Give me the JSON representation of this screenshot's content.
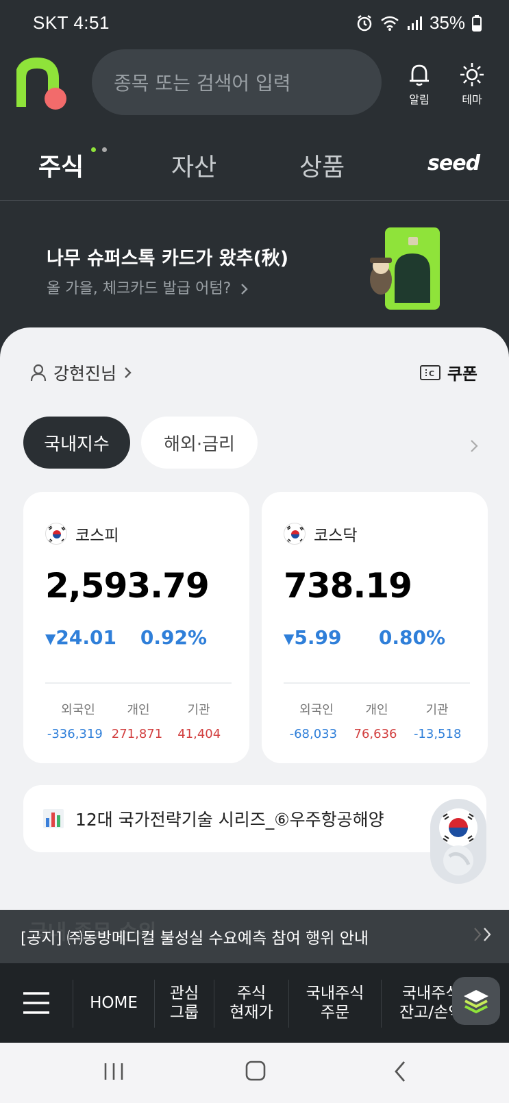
{
  "status_bar": {
    "carrier_time": "SKT 4:51",
    "battery": "35%"
  },
  "header": {
    "search_placeholder": "종목 또는 검색어 입력",
    "alarm_label": "알림",
    "theme_label": "테마"
  },
  "tabs": [
    {
      "label": "주식",
      "active": true
    },
    {
      "label": "자산",
      "active": false
    },
    {
      "label": "상품",
      "active": false
    },
    {
      "label": "seed",
      "active": false
    }
  ],
  "banner": {
    "title": "나무 슈퍼스톡 카드가 왔추(秋)",
    "subtitle": "올 가을, 체크카드 발급 어텀?"
  },
  "user": {
    "name": "강현진님",
    "coupon_label": "쿠폰"
  },
  "filter_pills": {
    "domestic": "국내지수",
    "overseas": "해외·금리"
  },
  "indices": [
    {
      "name": "코스피",
      "value": "2,593.79",
      "change": "24.01",
      "pct": "0.92%",
      "investor_labels": [
        "외국인",
        "개인",
        "기관"
      ],
      "investor_values": [
        "-336,319",
        "271,871",
        "41,404"
      ]
    },
    {
      "name": "코스닥",
      "value": "738.19",
      "change": "5.99",
      "pct": "0.80%",
      "investor_labels": [
        "외국인",
        "개인",
        "기관"
      ],
      "investor_values": [
        "-68,033",
        "76,636",
        "-13,518"
      ]
    }
  ],
  "news": {
    "text": "12대 국가전략기술 시리즈_⑥우주항공해양"
  },
  "notice": {
    "text": "[공지] ㈜동방메디컬 불성실 수요예측 참여 행위 안내",
    "ghost": "국내 종목 순위"
  },
  "bottom_nav": {
    "home": "HOME",
    "watch_line1": "관심",
    "watch_line2": "그룹",
    "price_line1": "주식",
    "price_line2": "현재가",
    "order_line1": "국내주식",
    "order_line2": "주문",
    "balance_line1": "국내주식",
    "balance_line2": "잔고/손익"
  },
  "colors": {
    "accent_green": "#8fe33a",
    "logo_red": "#f26b6b",
    "down_blue": "#2f7fd9",
    "up_red": "#d23f3f"
  }
}
